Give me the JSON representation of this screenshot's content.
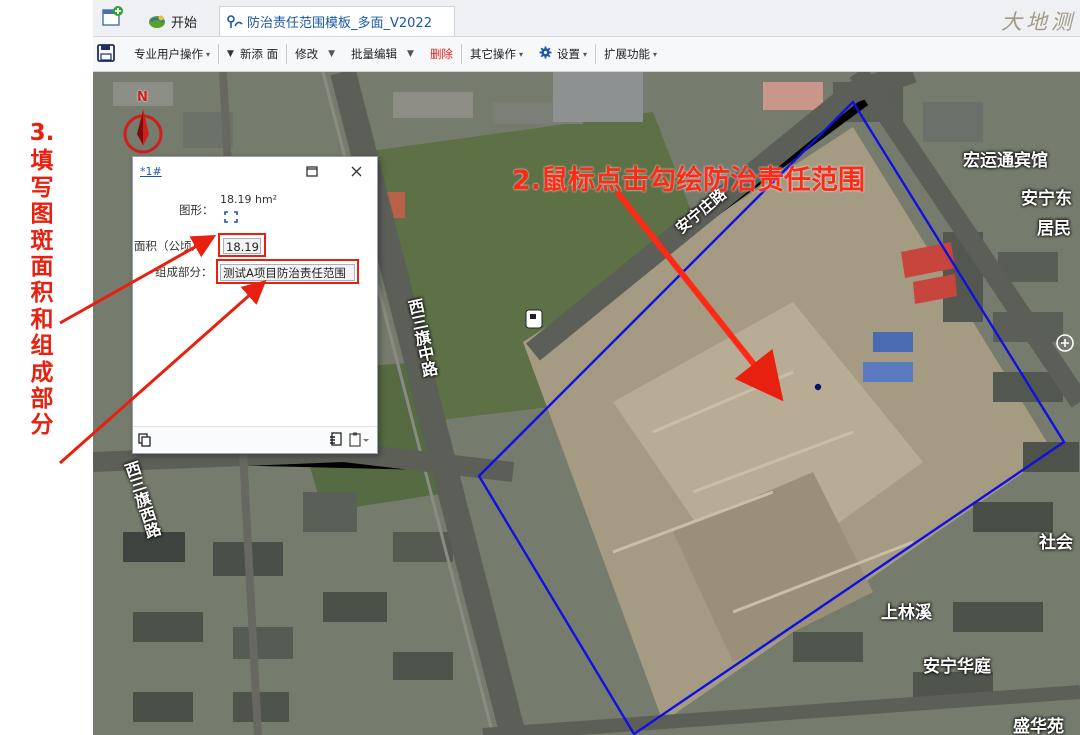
{
  "annotation_left": {
    "step_number": "3.",
    "chars": [
      "填",
      "写",
      "图",
      "斑",
      "面",
      "积",
      "和",
      "组",
      "成",
      "部",
      "分"
    ]
  },
  "tabs": {
    "start_label": "开始",
    "doc_label": "防治责任范围模板_多面_V2022"
  },
  "brand": "大地测",
  "toolbar": {
    "pro_ops": "专业用户操作",
    "new_face": "新添 面",
    "modify": "修改",
    "batch_edit": "批量编辑",
    "delete": "删除",
    "other_ops": "其它操作",
    "settings": "设置",
    "extensions": "扩展功能"
  },
  "map": {
    "instruction": "2.鼠标点击勾绘防治责任范围",
    "north_label": "N",
    "road_labels": [
      "安宁庄路",
      "西三旗中路",
      "西三旗西路"
    ],
    "place_labels": [
      "宏运通宾馆",
      "安宁东",
      "居民",
      "社会",
      "上林溪",
      "安宁华庭",
      "盛华苑"
    ]
  },
  "dialog": {
    "tab_label": "*1#",
    "shape_label": "图形：",
    "shape_value": "18.19 hm²",
    "area_label": "面积（公顷）：",
    "area_value": "18.19",
    "part_label": "组成部分：",
    "part_value": "测试A项目防治责任范围"
  },
  "colors": {
    "annotation_red": "#e8200f",
    "polygon_blue": "#1010e0",
    "accent_blue": "#1a57a8"
  }
}
